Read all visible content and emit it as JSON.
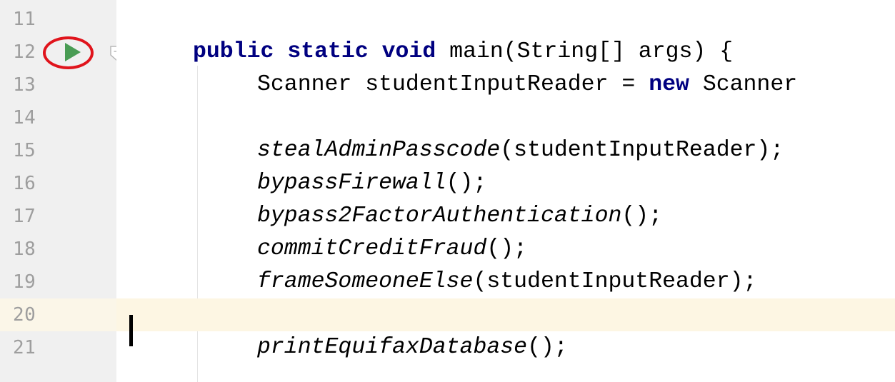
{
  "editor": {
    "lines": [
      {
        "number": "11",
        "tokens": []
      },
      {
        "number": "12",
        "tokens": [
          {
            "text": "public static void",
            "kind": "keyword"
          },
          {
            "text": " main(String[] args) {",
            "kind": "plain"
          }
        ]
      },
      {
        "number": "13",
        "tokens": [
          {
            "text": "Scanner studentInputReader = ",
            "kind": "plain"
          },
          {
            "text": "new",
            "kind": "keyword"
          },
          {
            "text": " Scanner",
            "kind": "plain"
          }
        ]
      },
      {
        "number": "14",
        "tokens": []
      },
      {
        "number": "15",
        "tokens": [
          {
            "text": "stealAdminPasscode",
            "kind": "method"
          },
          {
            "text": "(studentInputReader);",
            "kind": "plain"
          }
        ]
      },
      {
        "number": "16",
        "tokens": [
          {
            "text": "bypassFirewall",
            "kind": "method"
          },
          {
            "text": "();",
            "kind": "plain"
          }
        ]
      },
      {
        "number": "17",
        "tokens": [
          {
            "text": "bypass2FactorAuthentication",
            "kind": "method"
          },
          {
            "text": "();",
            "kind": "plain"
          }
        ]
      },
      {
        "number": "18",
        "tokens": [
          {
            "text": "commitCreditFraud",
            "kind": "method"
          },
          {
            "text": "();",
            "kind": "plain"
          }
        ]
      },
      {
        "number": "19",
        "tokens": [
          {
            "text": "frameSomeoneElse",
            "kind": "method"
          },
          {
            "text": "(studentInputReader);",
            "kind": "plain"
          }
        ]
      },
      {
        "number": "20",
        "tokens": []
      },
      {
        "number": "21",
        "tokens": [
          {
            "text": "printEquifaxDatabase",
            "kind": "method"
          },
          {
            "text": "();",
            "kind": "plain"
          }
        ]
      }
    ],
    "current_line": "20",
    "run_icon": "run-triangle-icon",
    "fold_icon": "fold-marker-icon",
    "colors": {
      "keyword": "#000080",
      "line_number": "#9e9e9e",
      "current_line_bg": "#fdf6e3",
      "gutter_bg": "#f0f0f0",
      "run_icon": "#499c54",
      "annotation_circle": "#e0141c"
    }
  }
}
